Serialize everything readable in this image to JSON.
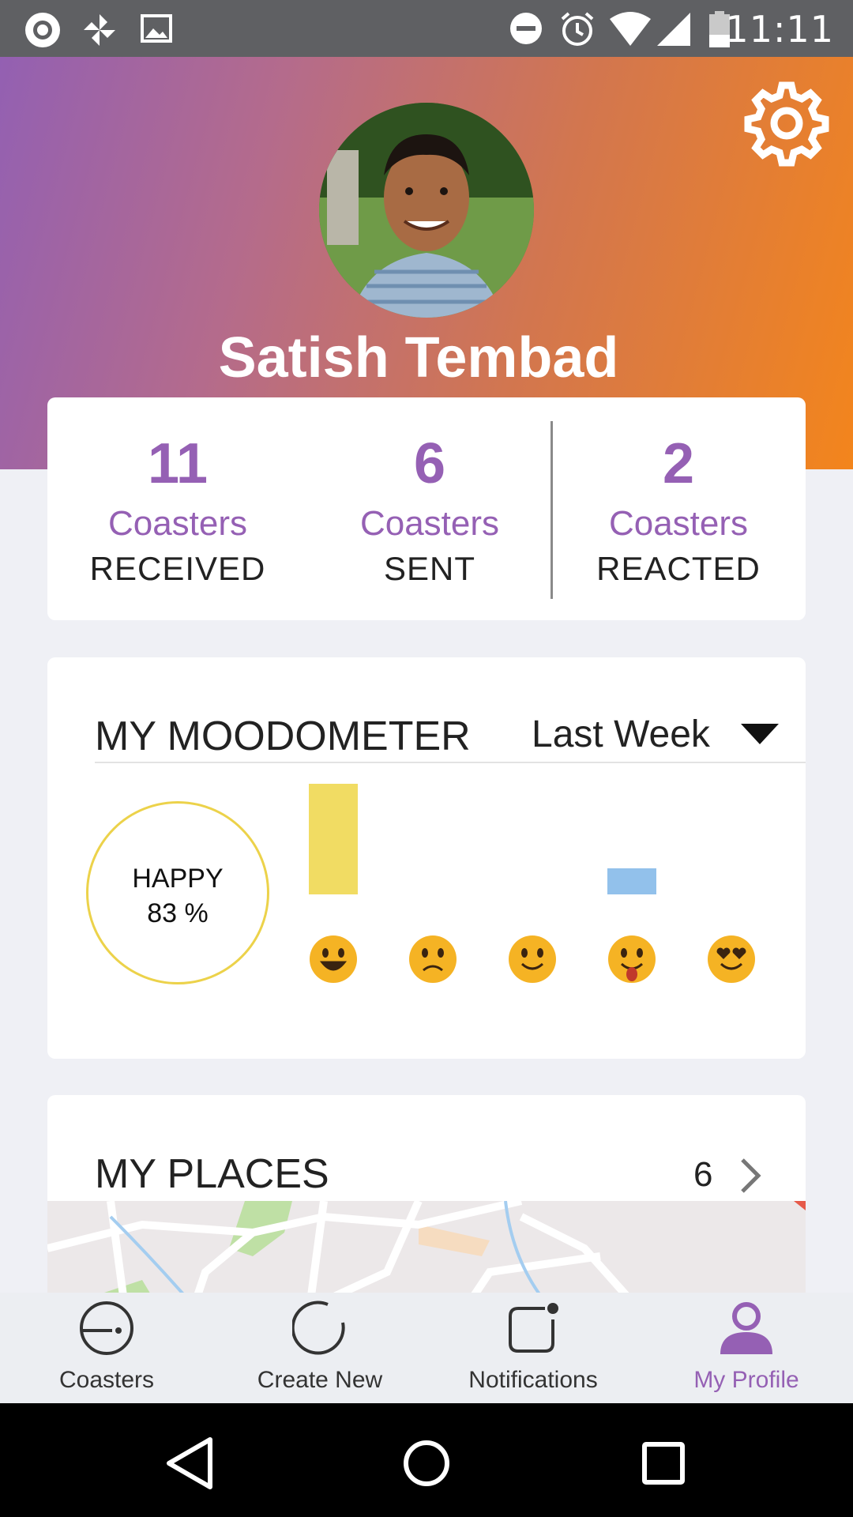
{
  "status_bar": {
    "time": "11:11",
    "left_icons": [
      "app-ring-icon",
      "pinwheel-icon",
      "image-icon"
    ],
    "right_icons": [
      "do-not-disturb-icon",
      "alarm-icon",
      "wifi-icon",
      "signal-icon",
      "battery-icon"
    ]
  },
  "profile": {
    "name": "Satish Tembad",
    "avatar": "profile-photo",
    "settings_icon": "gear-icon"
  },
  "stats": [
    {
      "value": "11",
      "label": "Coasters",
      "sub": "RECEIVED"
    },
    {
      "value": "6",
      "label": "Coasters",
      "sub": "SENT"
    },
    {
      "value": "2",
      "label": "Coasters",
      "sub": "REACTED"
    }
  ],
  "moodometer": {
    "title": "MY MOODOMETER",
    "period": "Last Week",
    "summary_label": "HAPPY",
    "summary_value": "83 %",
    "colors": {
      "bar_primary": "#f1dc63",
      "bar_secondary": "#92c1eb",
      "ring": "#ecd24a",
      "emoji": "#f5b324"
    },
    "chart_data": {
      "type": "bar",
      "categories": [
        "happy",
        "sad",
        "smile",
        "tongue-out",
        "love"
      ],
      "values": [
        5,
        0,
        0,
        1,
        0
      ]
    }
  },
  "places": {
    "title": "MY PLACES",
    "count": "6"
  },
  "bottom_nav": [
    {
      "label": "Coasters",
      "icon": "coaster-icon",
      "active": false
    },
    {
      "label": "Create New",
      "icon": "create-circle-icon",
      "active": false
    },
    {
      "label": "Notifications",
      "icon": "notification-icon",
      "active": false
    },
    {
      "label": "My Profile",
      "icon": "user-icon",
      "active": true
    }
  ],
  "accent_color": "#9560b4"
}
